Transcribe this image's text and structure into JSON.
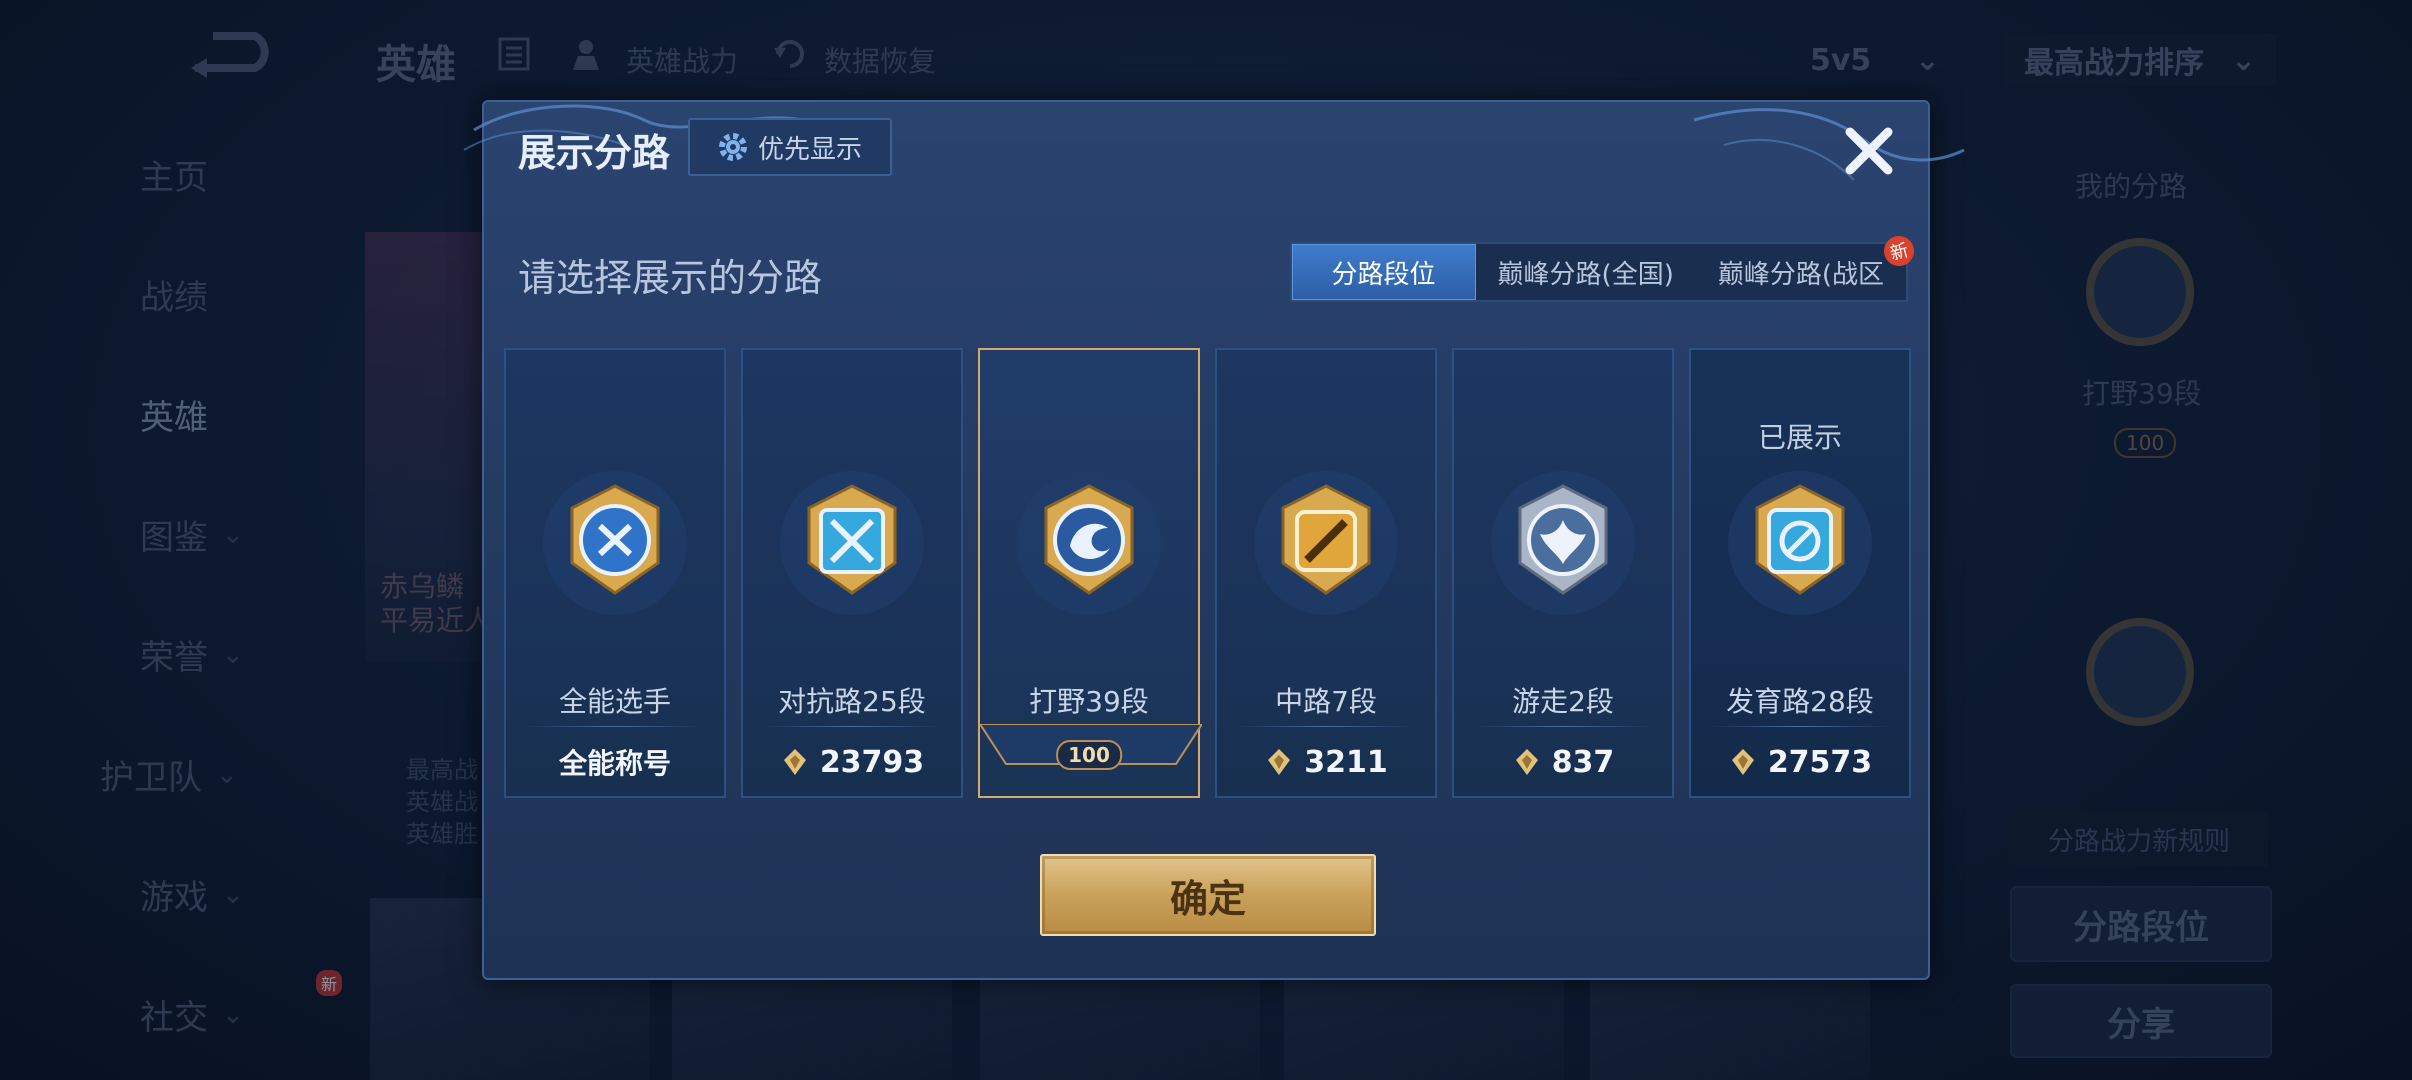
{
  "background": {
    "title": "英雄",
    "hero_power_label": "英雄战力",
    "data_restore_label": "数据恢复",
    "mode_select": "5v5",
    "sort_select": "最高战力排序",
    "nav": [
      {
        "label": "主页"
      },
      {
        "label": "战绩"
      },
      {
        "label": "英雄"
      },
      {
        "label": "图鉴"
      },
      {
        "label": "荣誉"
      },
      {
        "label": "护卫队"
      },
      {
        "label": "游戏"
      },
      {
        "label": "社交"
      }
    ],
    "nav_new_badge": "新",
    "right_panel": {
      "my_lanes": "我的分路",
      "jungle_rank": "打野39段",
      "star_count": "100",
      "rules_label": "分路战力新规则",
      "lane_rank_button": "分路段位",
      "share_button": "分享"
    },
    "hero_card_text": [
      "赤乌鳞",
      "平易近人"
    ],
    "hero_stats_text": [
      "最高战",
      "英雄战",
      "英雄胜"
    ]
  },
  "modal": {
    "title": "展示分路",
    "priority_button": "优先显示",
    "subtitle": "请选择展示的分路",
    "tabs": [
      {
        "label": "分路段位",
        "active": true
      },
      {
        "label": "巅峰分路(全国)",
        "active": false
      },
      {
        "label": "巅峰分路(战区",
        "active": false,
        "badge": "新"
      }
    ],
    "cards": [
      {
        "name": "全能选手",
        "value": "全能称号",
        "has_power_icon": false,
        "selected": false,
        "shown_label": ""
      },
      {
        "name": "对抗路25段",
        "value": "23793",
        "has_power_icon": true,
        "selected": false,
        "shown_label": ""
      },
      {
        "name": "打野39段",
        "value": "",
        "has_power_icon": false,
        "selected": true,
        "shown_label": "",
        "star_count": "100"
      },
      {
        "name": "中路7段",
        "value": "3211",
        "has_power_icon": true,
        "selected": false,
        "shown_label": ""
      },
      {
        "name": "游走2段",
        "value": "837",
        "has_power_icon": true,
        "selected": false,
        "shown_label": ""
      },
      {
        "name": "发育路28段",
        "value": "27573",
        "has_power_icon": true,
        "selected": false,
        "shown_label": "已展示"
      }
    ],
    "confirm_button": "确定"
  },
  "colors": {
    "gold": "#d6a96b",
    "accent_blue": "#3f7ccc",
    "new_badge_red": "#d9432d"
  }
}
